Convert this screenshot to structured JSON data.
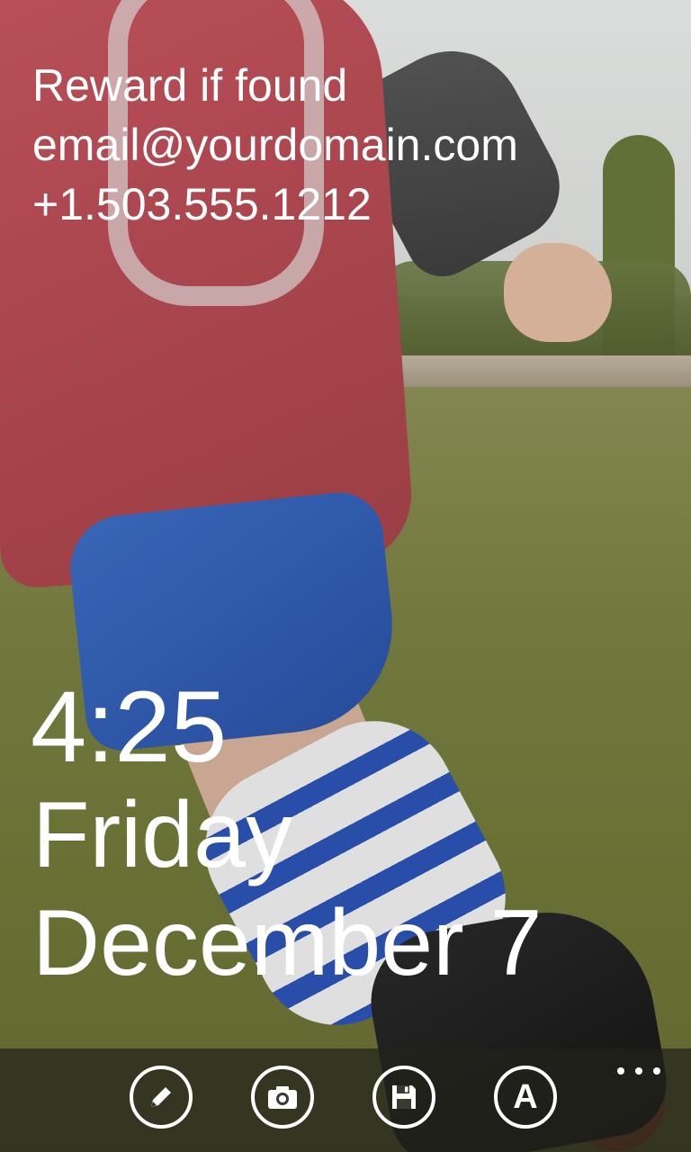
{
  "owner_info": {
    "line1": "Reward if found",
    "line2": "email@yourdomain.com",
    "line3": "+1.503.555.1212"
  },
  "clock": {
    "time": "4:25",
    "day": "Friday",
    "date": "December 7"
  },
  "app_bar": {
    "buttons": [
      {
        "icon": "pencil-icon"
      },
      {
        "icon": "camera-icon"
      },
      {
        "icon": "save-icon"
      },
      {
        "icon": "font-icon",
        "glyph": "A"
      }
    ],
    "more_icon": "ellipsis-icon"
  }
}
